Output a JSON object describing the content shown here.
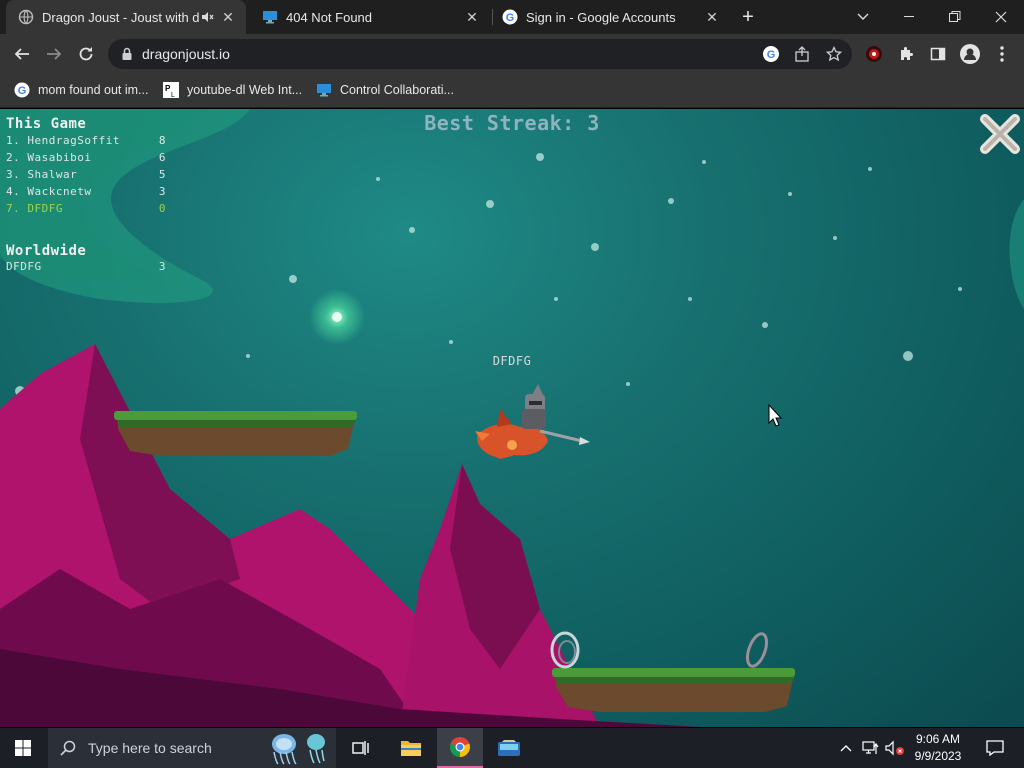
{
  "tabs": [
    {
      "title": "Dragon Joust - Joust with dr",
      "active": true
    },
    {
      "title": "404 Not Found",
      "active": false
    },
    {
      "title": "Sign in - Google Accounts",
      "active": false
    }
  ],
  "toolbar": {
    "url": "dragonjoust.io"
  },
  "bookmarks": [
    {
      "label": "mom found out im..."
    },
    {
      "label": "youtube-dl Web Int..."
    },
    {
      "label": "Control Collaborati..."
    }
  ],
  "game": {
    "best_streak": "Best Streak: 3",
    "this_game_title": "This Game",
    "this_game": [
      {
        "rank": "1. HendragSoffit",
        "score": "8"
      },
      {
        "rank": "2. Wasabiboi",
        "score": "6"
      },
      {
        "rank": "3. Shalwar",
        "score": "5"
      },
      {
        "rank": "4. Wackcnetw",
        "score": "3"
      },
      {
        "rank": "7. DFDFG",
        "score": "0",
        "highlight": true
      }
    ],
    "worldwide_title": "Worldwide",
    "worldwide": [
      {
        "rank": "DFDFG",
        "score": "3"
      }
    ],
    "player_name": "DFDFG"
  },
  "taskbar": {
    "search_placeholder": "Type here to search",
    "time": "9:06 AM",
    "date": "9/9/2023"
  },
  "colors": {
    "highlight": "#9bd44a",
    "tab_active": "#353535",
    "tabstrip": "#1f1f1f",
    "taskbar": "#1c1f26"
  }
}
